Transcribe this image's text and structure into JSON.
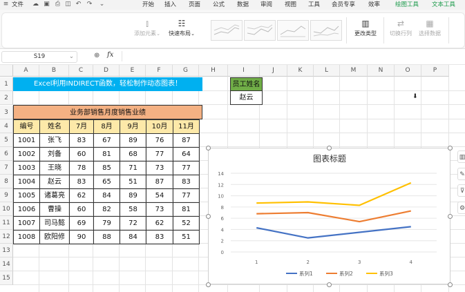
{
  "menubar": {
    "file": "文件",
    "items": [
      "开始",
      "插入",
      "页面",
      "公式",
      "数据",
      "审阅",
      "视图",
      "工具",
      "会员专享",
      "效率"
    ],
    "context_tabs": [
      "绘图工具",
      "文本工具"
    ]
  },
  "ribbon": {
    "add_element": "添加元素",
    "quick_layout": "快速布局",
    "change_type": "更改类型",
    "switch_row_col": "切换行列",
    "select_data": "选择数据"
  },
  "formula_bar": {
    "name_box": "S19",
    "fx": "fx",
    "content": ""
  },
  "columns": [
    "A",
    "B",
    "C",
    "D",
    "E",
    "F",
    "G",
    "H",
    "I",
    "J",
    "K",
    "L",
    "M",
    "N",
    "O",
    "P"
  ],
  "rows": [
    "1",
    "2",
    "3",
    "4",
    "5",
    "6",
    "7",
    "8",
    "9",
    "10",
    "11",
    "12",
    "13",
    "14",
    "15"
  ],
  "sheet": {
    "banner": "Excel利用INDIRECT函数，轻松制作动态图表！",
    "table_title": "业务部销售月度销售业绩",
    "headers": [
      "编号",
      "姓名",
      "7月",
      "8月",
      "9月",
      "10月",
      "11月"
    ],
    "data": [
      [
        "1001",
        "张飞",
        "83",
        "67",
        "89",
        "76",
        "87"
      ],
      [
        "1002",
        "刘备",
        "60",
        "81",
        "68",
        "77",
        "64"
      ],
      [
        "1003",
        "王晓",
        "78",
        "85",
        "71",
        "73",
        "77"
      ],
      [
        "1004",
        "赵云",
        "83",
        "65",
        "51",
        "87",
        "83"
      ],
      [
        "1005",
        "诸葛亮",
        "62",
        "84",
        "89",
        "54",
        "77"
      ],
      [
        "1006",
        "曹操",
        "60",
        "82",
        "58",
        "73",
        "81"
      ],
      [
        "1007",
        "司马懿",
        "69",
        "79",
        "72",
        "62",
        "52"
      ],
      [
        "1008",
        "欧阳修",
        "90",
        "88",
        "84",
        "83",
        "51"
      ]
    ],
    "lookup_label": "员工姓名",
    "lookup_value": "赵云"
  },
  "colors": {
    "banner": "#00b0f0",
    "table_title_bg": "#f4b183",
    "header_bg": "#fde9a9",
    "lookup_label_bg": "#70ad47",
    "accent_green": "#1a9a4a"
  },
  "chart_data": {
    "type": "line",
    "title": "图表标题",
    "x": [
      "1",
      "2",
      "3",
      "4"
    ],
    "ylim": [
      0,
      14
    ],
    "yticks": [
      "0",
      "2",
      "4",
      "6",
      "8",
      "10",
      "12",
      "14"
    ],
    "grid": true,
    "legend": "bottom",
    "series": [
      {
        "name": "系列1",
        "color": "#4472c4",
        "values": [
          4.3,
          2.5,
          3.5,
          4.5
        ]
      },
      {
        "name": "系列2",
        "color": "#ed7d31",
        "values": [
          6.8,
          7.0,
          5.4,
          7.3
        ]
      },
      {
        "name": "系列3",
        "color": "#ffc000",
        "values": [
          8.7,
          8.9,
          8.3,
          12.3
        ]
      }
    ]
  }
}
